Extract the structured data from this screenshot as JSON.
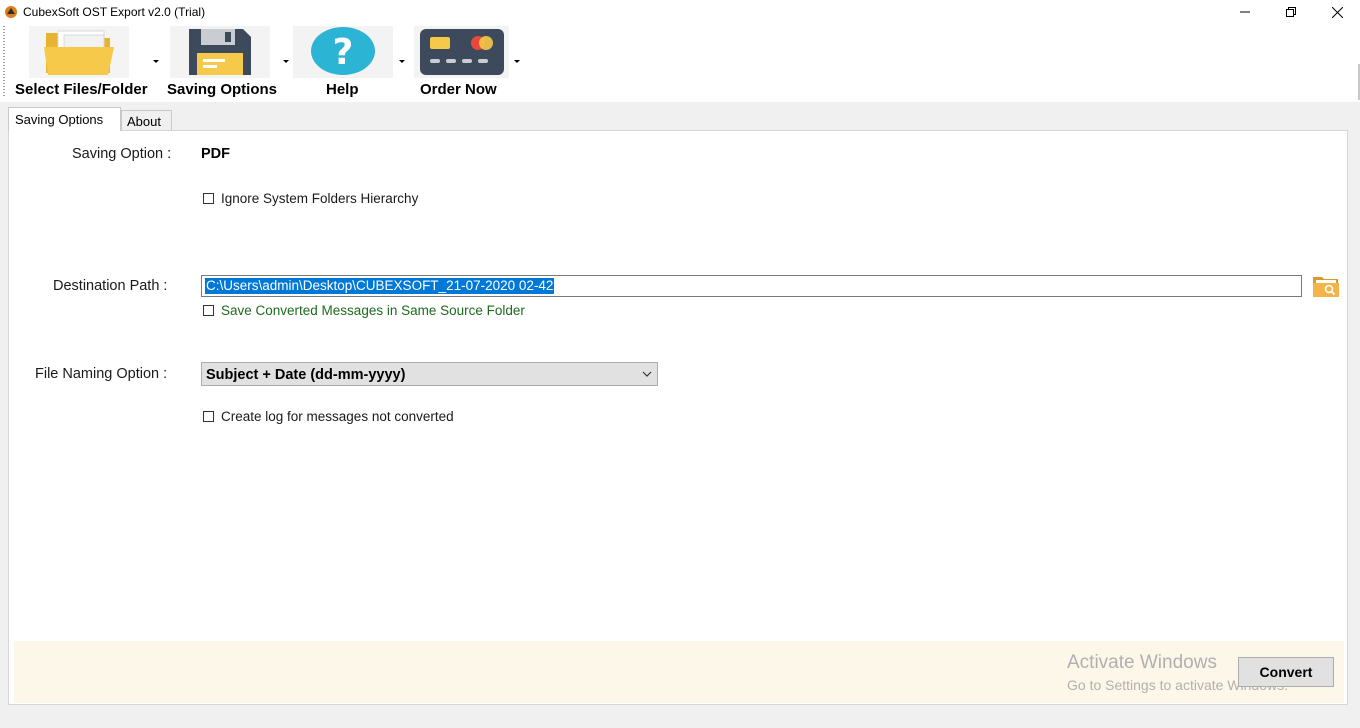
{
  "window": {
    "title": "CubexSoft OST Export v2.0 (Trial)",
    "icon": "app-logo-icon",
    "controls": [
      "minimize-icon",
      "restore-icon",
      "close-icon"
    ]
  },
  "toolbar": {
    "items": [
      {
        "label": "Select Files/Folder",
        "icon": "folder-icon"
      },
      {
        "label": "Saving Options",
        "icon": "floppy-disk-icon"
      },
      {
        "label": "Help",
        "icon": "help-question-icon"
      },
      {
        "label": "Order Now",
        "icon": "credit-card-icon"
      }
    ]
  },
  "tabs": [
    {
      "label": "Saving Options",
      "active": true
    },
    {
      "label": "About",
      "active": false
    }
  ],
  "form": {
    "saving_option_label": "Saving Option :",
    "saving_option_value": "PDF",
    "ignore_hierarchy_label": "Ignore System Folders Hierarchy",
    "destination_label": "Destination Path :",
    "destination_value": "C:\\Users\\admin\\Desktop\\CUBEXSOFT_21-07-2020 02-42",
    "same_source_label": "Save Converted Messages in Same Source Folder",
    "file_naming_label": "File Naming Option :",
    "file_naming_value": "Subject + Date (dd-mm-yyyy)",
    "create_log_label": "Create log for messages not converted"
  },
  "footer": {
    "convert_label": "Convert",
    "watermark_title": "Activate Windows",
    "watermark_sub": "Go to Settings to activate Windows."
  },
  "colors": {
    "selection": "#0078d7",
    "footer_bg": "#fdf7e9",
    "green_text": "#1e6b1e",
    "folder": "#f6c94a",
    "help": "#2cb4d4",
    "card": "#3d4a5c"
  }
}
